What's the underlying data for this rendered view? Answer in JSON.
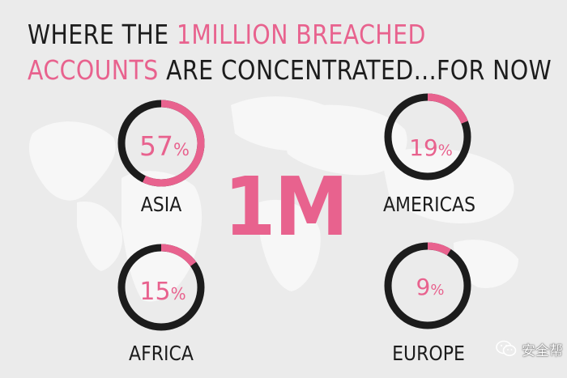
{
  "title": {
    "line1_pre": "WHERE THE ",
    "line1_highlight": "1MILLION BREACHED",
    "line2_highlight": "ACCOUNTS",
    "line2_post": " ARE CONCENTRATED...FOR NOW"
  },
  "center_label": "1M",
  "colors": {
    "accent": "#e8628e",
    "ring": "#1c1c1c",
    "background": "#ebebeb",
    "map": "#f7f7f7",
    "text": "#1c1c1c"
  },
  "chart_data": {
    "type": "pie",
    "style": "donut-gauges",
    "title": "WHERE THE 1MILLION BREACHED ACCOUNTS ARE CONCENTRATED...FOR NOW",
    "total_label": "1M",
    "categories": [
      "ASIA",
      "AMERICAS",
      "AFRICA",
      "EUROPE"
    ],
    "values": [
      57,
      19,
      15,
      9
    ],
    "unit": "%",
    "series": [
      {
        "name": "ASIA",
        "value": 57,
        "label": "57",
        "unit": "%"
      },
      {
        "name": "AMERICAS",
        "value": 19,
        "label": "19",
        "unit": "%"
      },
      {
        "name": "AFRICA",
        "value": 15,
        "label": "15",
        "unit": "%"
      },
      {
        "name": "EUROPE",
        "value": 9,
        "label": "9",
        "unit": "%"
      }
    ]
  },
  "watermark": {
    "text": "安全帮",
    "icon": "wechat-icon"
  }
}
